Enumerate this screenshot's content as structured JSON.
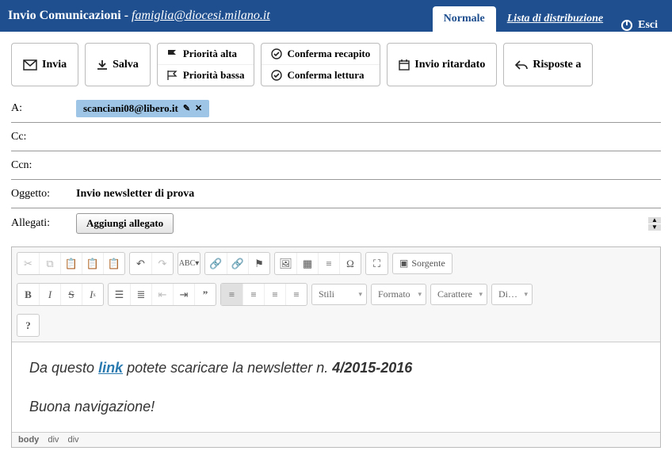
{
  "header": {
    "title_prefix": "Invio Comunicazioni",
    "account": "famiglia@diocesi.milano.it",
    "tab_normal": "Normale",
    "tab_list": "Lista di distribuzione",
    "exit": "Esci"
  },
  "toolbar": {
    "send": "Invia",
    "save": "Salva",
    "prio_high": "Priorità alta",
    "prio_low": "Priorità bassa",
    "confirm_delivery": "Conferma recapito",
    "confirm_read": "Conferma lettura",
    "delayed": "Invio ritardato",
    "reply_to": "Risposte a"
  },
  "fields": {
    "to_label": "A:",
    "to_value": "scanciani08@libero.it",
    "cc_label": "Cc:",
    "bcc_label": "Ccn:",
    "subject_label": "Oggetto:",
    "subject_value": "Invio newsletter di prova",
    "attach_label": "Allegati:",
    "attach_button": "Aggiungi allegato"
  },
  "editor": {
    "styles": "Stili",
    "format": "Formato",
    "font": "Carattere",
    "size": "Di…",
    "source": "Sorgente",
    "content_pre": "Da questo ",
    "content_link": "link",
    "content_post": " potete scaricare la newsletter n. ",
    "content_bold": "4/2015-2016",
    "content_line2": "Buona navigazione!",
    "path": [
      "body",
      "div",
      "div"
    ]
  }
}
